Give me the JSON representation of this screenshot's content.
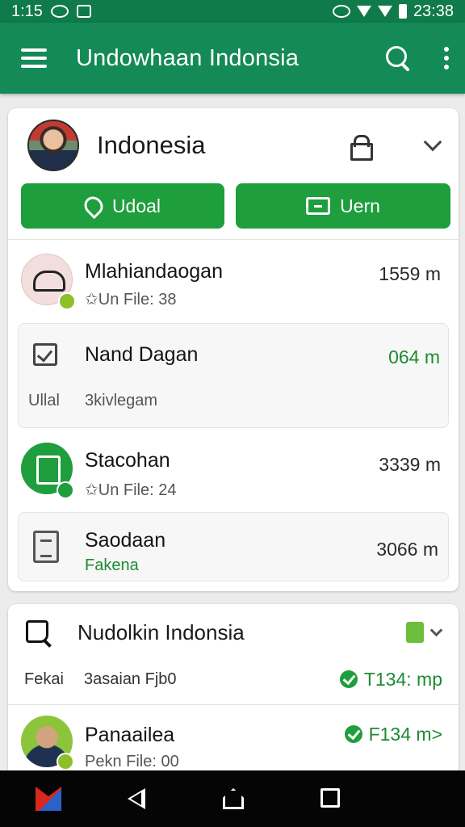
{
  "status_bar": {
    "time_left": "1:15",
    "time_right": "23:38"
  },
  "app_bar": {
    "title": "Undowhaan Indonsia"
  },
  "card1": {
    "title": "Indonesia",
    "buttons": {
      "upload_label": "Udoal",
      "view_label": "Uern"
    },
    "items": [
      {
        "title": "Mlahiandaogan",
        "sub": "✩Un File: 38",
        "meta": "1559 m"
      },
      {
        "title": "Nand Dagan",
        "sub_left": "Ullal",
        "sub": "3kivlegam",
        "meta": "064 m"
      },
      {
        "title": "Stacohan",
        "sub": "✩Un File: 24",
        "meta": "3339 m"
      },
      {
        "title": "Saodaan",
        "sub": "Fakena",
        "meta": "3066 m"
      }
    ]
  },
  "card2": {
    "title": "Nudolkin Indonsia",
    "info_row": {
      "left": "Fekai",
      "middle": "3asaian Fjb0",
      "right": "T134: mp"
    },
    "items": [
      {
        "title": "Panaailea",
        "sub": "Pekn File: 00",
        "meta": "F134 m>"
      }
    ]
  },
  "colors": {
    "app_bar": "#148a56",
    "accent_green": "#1e9e3c"
  },
  "icons": [
    "menu-icon",
    "search-icon",
    "more-icon",
    "lock-icon",
    "chevron-down-icon",
    "check-icon",
    "document-icon",
    "folder-icon"
  ]
}
